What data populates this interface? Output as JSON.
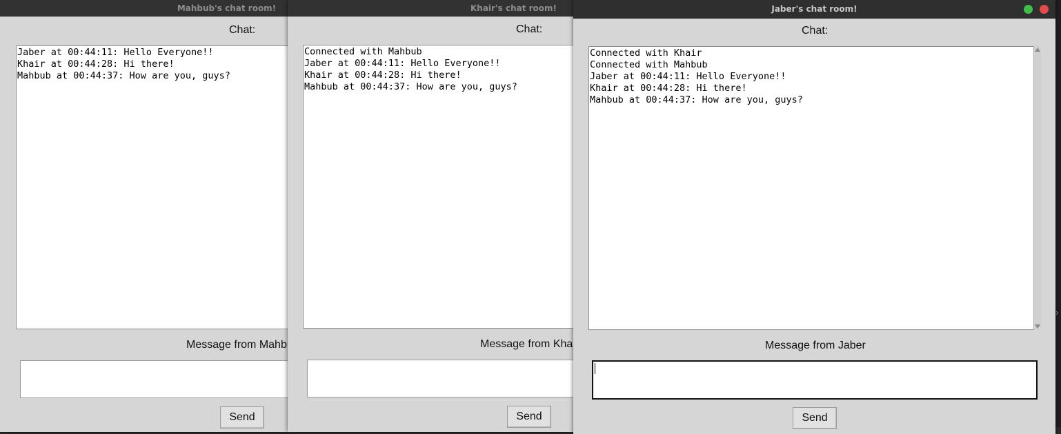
{
  "windows": [
    {
      "title": "Mahbub's chat room!",
      "chat_label": "Chat:",
      "messages": [
        "Jaber at 00:44:11: Hello Everyone!!",
        "Khair at 00:44:28: Hi there!",
        "Mahbub at 00:44:37: How are you, guys?"
      ],
      "message_label": "Message from Mahbub",
      "input_value": "",
      "send_label": "Send"
    },
    {
      "title": "Khair's chat room!",
      "chat_label": "Chat:",
      "messages": [
        "Connected with Mahbub",
        "Jaber at 00:44:11: Hello Everyone!!",
        "Khair at 00:44:28: Hi there!",
        "Mahbub at 00:44:37: How are you, guys?"
      ],
      "message_label": "Message from Khair",
      "input_value": "",
      "send_label": "Send"
    },
    {
      "title": "Jaber's chat room!",
      "chat_label": "Chat:",
      "messages": [
        "Connected with Khair",
        "Connected with Mahbub",
        "Jaber at 00:44:11: Hello Everyone!!",
        "Khair at 00:44:28: Hi there!",
        "Mahbub at 00:44:37: How are you, guys?"
      ],
      "message_label": "Message from Jaber",
      "input_value": "",
      "send_label": "Send"
    }
  ],
  "colors": {
    "titlebar": "#323232",
    "window_bg": "#d6d6d6",
    "maximize": "#3fbf4a",
    "close": "#e64b4b"
  }
}
